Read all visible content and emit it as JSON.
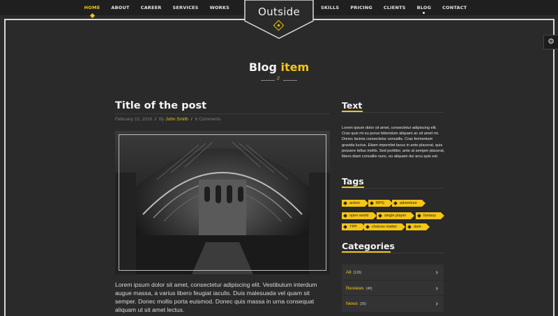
{
  "nav": {
    "left": [
      {
        "label": "HOME",
        "active": true
      },
      {
        "label": "ABOUT"
      },
      {
        "label": "CAREER"
      },
      {
        "label": "SERVICES"
      },
      {
        "label": "WORKS"
      }
    ],
    "right": [
      {
        "label": "SKILLS"
      },
      {
        "label": "PRICING"
      },
      {
        "label": "CLIENTS"
      },
      {
        "label": "BLOG",
        "current": true
      },
      {
        "label": "CONTACT"
      }
    ]
  },
  "logo": {
    "text": "Outside"
  },
  "settings": {
    "icon": "gear-icon"
  },
  "page": {
    "title_main": "Blog ",
    "title_highlight": "item",
    "separator": "//"
  },
  "post": {
    "title": "Title of the post",
    "date": "February 15, 2016",
    "by": "By",
    "author": "John Smith",
    "comments": "6 Comments",
    "body": "Lorem ipsum dolor sit amet, consectetur adipiscing elit. Vestibulum interdum augue massa, a varius libero feugiat iaculis. Duis malesuada vel quam sit semper. Donec mollis porta euismod. Donec quis massa in urna consequat aliquam ut sit amet lectus."
  },
  "sidebar": {
    "text_heading": "Text",
    "text_body": "Lorem ipsum dolor sit amet, consectetur adipiscing elit. Cras quis mi eu purus bibendum aliquam ac sit amet mi. Donec lacinia consectetur convallis. Cras fermentum gravida luctus. Etiam imperdiet lacus in ante placerat, quis posuere tellus mollis. Sed porttitor, ante at semper placerat, libero diam convallis nunc, eu aliquam dui arcu quis est.",
    "tags_heading": "Tags",
    "tags": [
      "action",
      "RPG",
      "adventure",
      "open world",
      "single player",
      "fantasy",
      "TPP",
      "choices matter",
      "dark"
    ],
    "categories_heading": "Categories",
    "categories": [
      {
        "name": "All",
        "count": "(126)"
      },
      {
        "name": "Reviews",
        "count": "(40)"
      },
      {
        "name": "News",
        "count": "(26)"
      }
    ]
  },
  "colors": {
    "accent": "#f5c518",
    "background": "#2a2a2a",
    "panel": "#333333"
  }
}
